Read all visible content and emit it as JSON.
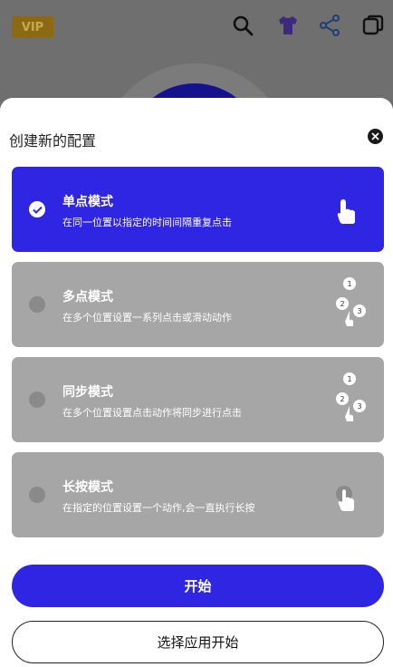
{
  "background": {
    "vip_label": "VIP",
    "icons": [
      "search-icon",
      "shirt-icon",
      "share-icon",
      "copy-icon"
    ]
  },
  "sheet": {
    "title": "创建新的配置",
    "close_icon": "close-icon",
    "modes": [
      {
        "title": "单点模式",
        "desc": "在同一位置以指定的时间间隔重复点击",
        "selected": true,
        "icon": "single-tap-icon"
      },
      {
        "title": "多点模式",
        "desc": "在多个位置设置一系列点击或滑动动作",
        "selected": false,
        "icon": "multi-tap-icon"
      },
      {
        "title": "同步模式",
        "desc": "在多个位置设置点击动作将同步进行点击",
        "selected": false,
        "icon": "sync-tap-icon"
      },
      {
        "title": "长按模式",
        "desc": "在指定的位置设置一个动作,会一直执行长按",
        "selected": false,
        "icon": "long-press-icon"
      }
    ],
    "start_label": "开始",
    "select_app_label": "选择应用开始"
  },
  "colors": {
    "accent": "#2f26e3",
    "inactive_card": "#a6a6a6",
    "vip_bg": "#8b6a13"
  }
}
